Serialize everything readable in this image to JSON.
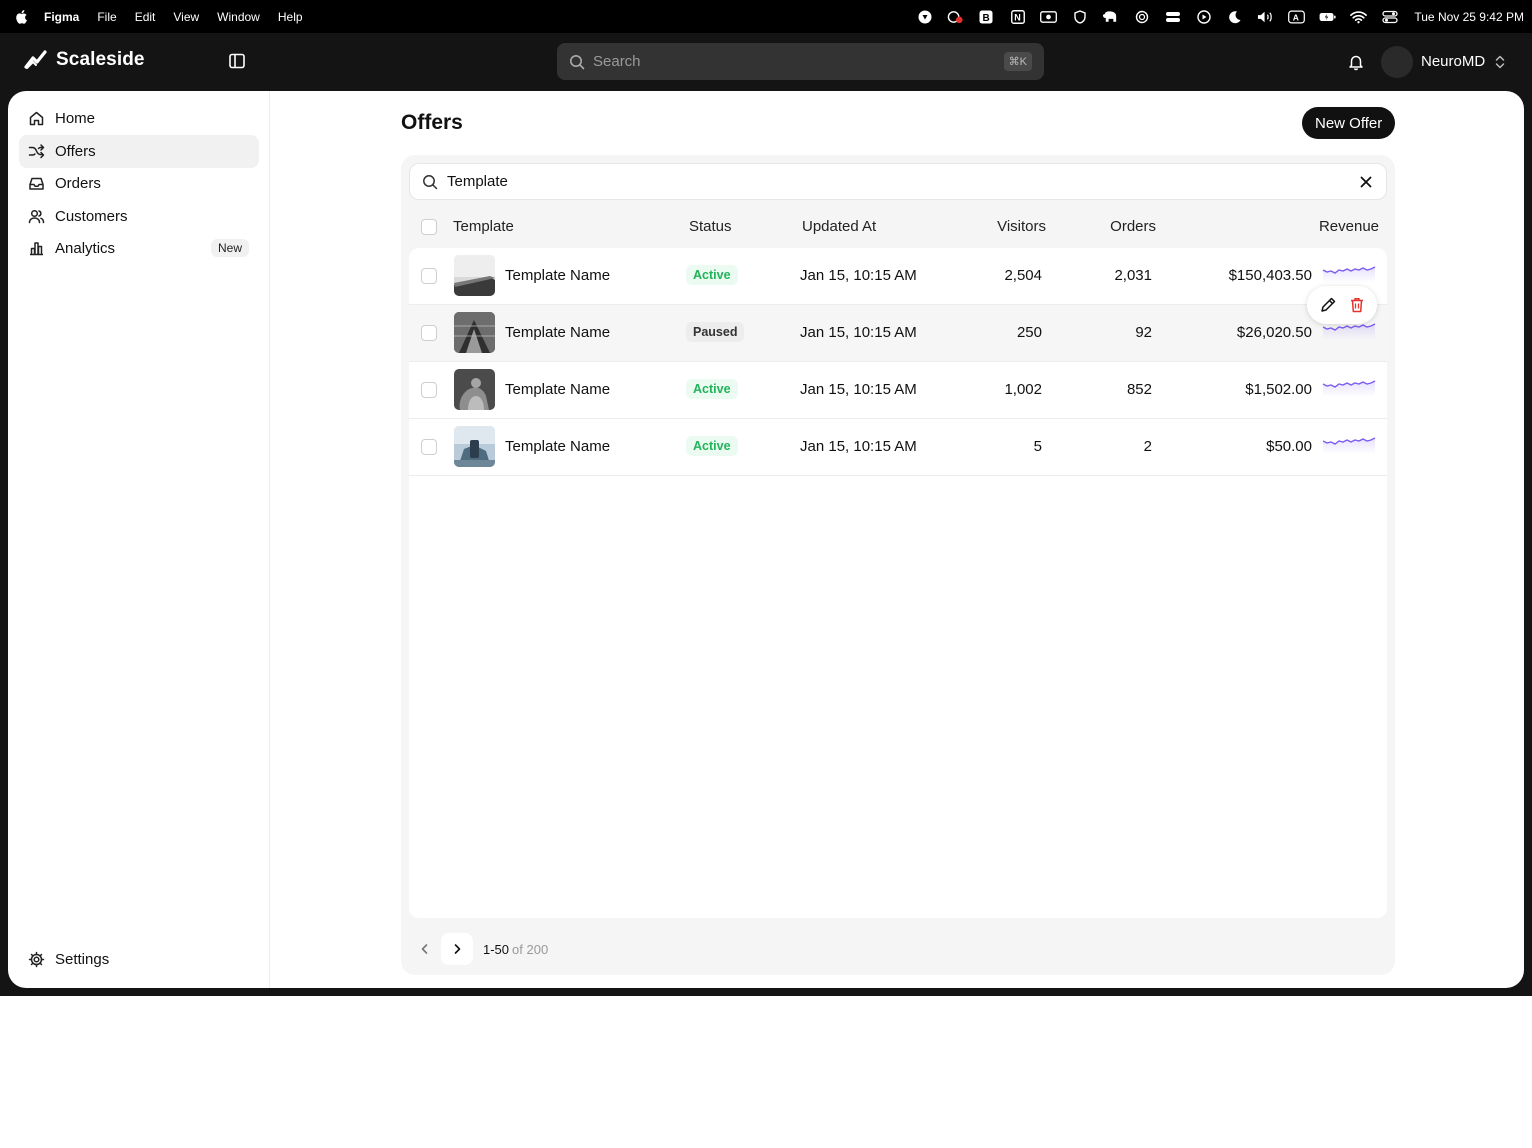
{
  "menubar": {
    "app": "Figma",
    "items": [
      "File",
      "Edit",
      "View",
      "Window",
      "Help"
    ],
    "clock": "Tue Nov 25  9:42 PM"
  },
  "topbar": {
    "brand": "Scaleside",
    "search_placeholder": "Search",
    "search_shortcut": "⌘K",
    "account_name": "NeuroMD"
  },
  "sidebar": {
    "items": [
      {
        "label": "Home",
        "icon": "home-icon"
      },
      {
        "label": "Offers",
        "icon": "shuffle-icon",
        "active": true
      },
      {
        "label": "Orders",
        "icon": "inbox-icon"
      },
      {
        "label": "Customers",
        "icon": "users-icon"
      },
      {
        "label": "Analytics",
        "icon": "bar-chart-icon",
        "badge": "New"
      }
    ],
    "settings_label": "Settings"
  },
  "main": {
    "title": "Offers",
    "new_button": "New Offer",
    "filter_value": "Template"
  },
  "table": {
    "columns": [
      "Template",
      "Status",
      "Updated At",
      "Visitors",
      "Orders",
      "Revenue"
    ],
    "rows": [
      {
        "name": "Template Name",
        "status": "Active",
        "updated": "Jan 15, 10:15 AM",
        "visitors": "2,504",
        "orders": "2,031",
        "revenue": "$150,403.50"
      },
      {
        "name": "Template Name",
        "status": "Paused",
        "updated": "Jan 15, 10:15 AM",
        "visitors": "250",
        "orders": "92",
        "revenue": "$26,020.50"
      },
      {
        "name": "Template Name",
        "status": "Active",
        "updated": "Jan 15, 10:15 AM",
        "visitors": "1,002",
        "orders": "852",
        "revenue": "$1,502.00"
      },
      {
        "name": "Template Name",
        "status": "Active",
        "updated": "Jan 15, 10:15 AM",
        "visitors": "5",
        "orders": "2",
        "revenue": "$50.00"
      }
    ]
  },
  "pagination": {
    "range": "1-50",
    "total": "of 200"
  },
  "colors": {
    "active_text": "#22b35a",
    "sparkline": "#7b5cf0",
    "delete": "#e5322d"
  }
}
